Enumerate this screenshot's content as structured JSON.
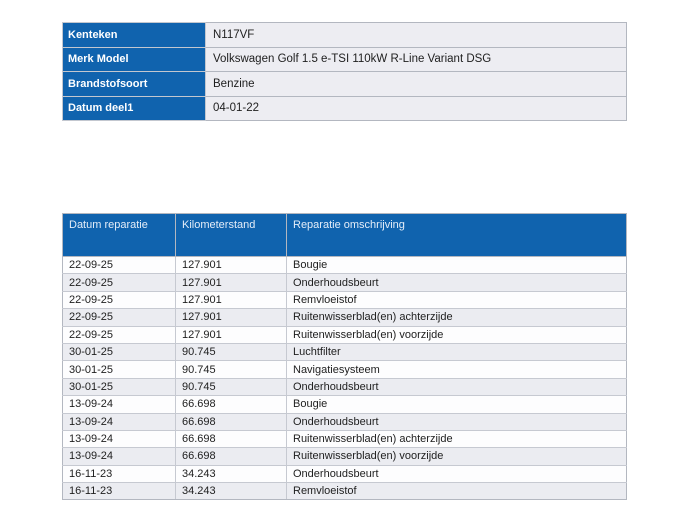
{
  "colors": {
    "header_blue": "#1063ae",
    "alt_row_gray": "#ebecf1",
    "value_cell_gray": "#ededf2",
    "border_gray": "#b3b7c0",
    "text_dark": "#1e1e1e"
  },
  "vehicle_info": {
    "rows": [
      {
        "label": "Kenteken",
        "value": "N117VF"
      },
      {
        "label": "Merk Model",
        "value": "Volkswagen Golf 1.5 e-TSI 110kW R-Line Variant DSG"
      },
      {
        "label": "Brandstofsoort",
        "value": "Benzine"
      },
      {
        "label": "Datum deel1",
        "value": "04-01-22"
      }
    ]
  },
  "repairs": {
    "columns": [
      "Datum reparatie",
      "Kilometerstand",
      "Reparatie omschrijving"
    ],
    "rows": [
      [
        "22-09-25",
        "127.901",
        "Bougie"
      ],
      [
        "22-09-25",
        "127.901",
        "Onderhoudsbeurt"
      ],
      [
        "22-09-25",
        "127.901",
        "Remvloeistof"
      ],
      [
        "22-09-25",
        "127.901",
        "Ruitenwisserblad(en) achterzijde"
      ],
      [
        "22-09-25",
        "127.901",
        "Ruitenwisserblad(en) voorzijde"
      ],
      [
        "30-01-25",
        "90.745",
        "Luchtfilter"
      ],
      [
        "30-01-25",
        "90.745",
        "Navigatiesysteem"
      ],
      [
        "30-01-25",
        "90.745",
        "Onderhoudsbeurt"
      ],
      [
        "13-09-24",
        "66.698",
        "Bougie"
      ],
      [
        "13-09-24",
        "66.698",
        "Onderhoudsbeurt"
      ],
      [
        "13-09-24",
        "66.698",
        "Ruitenwisserblad(en) achterzijde"
      ],
      [
        "13-09-24",
        "66.698",
        "Ruitenwisserblad(en) voorzijde"
      ],
      [
        "16-11-23",
        "34.243",
        "Onderhoudsbeurt"
      ],
      [
        "16-11-23",
        "34.243",
        "Remvloeistof"
      ]
    ]
  }
}
